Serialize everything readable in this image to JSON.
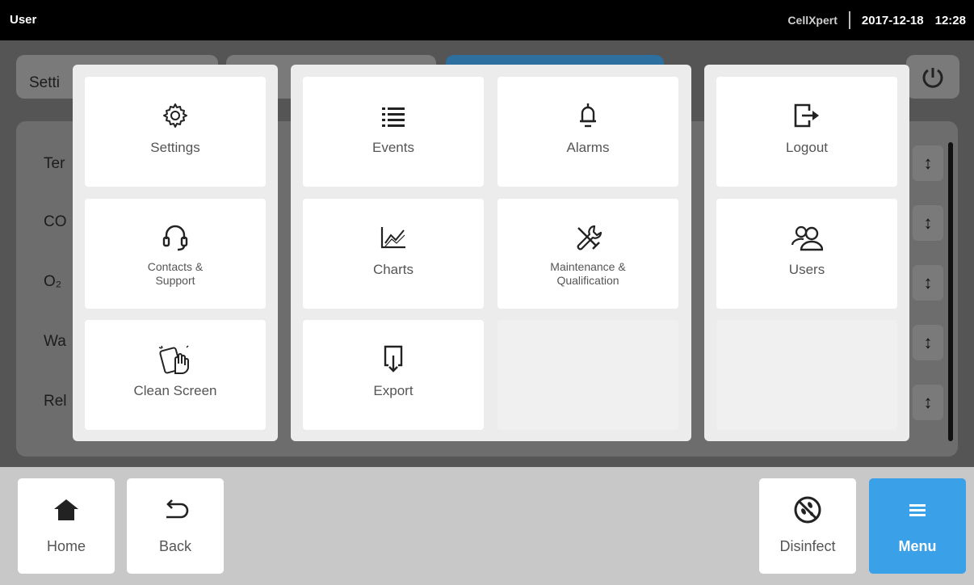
{
  "topbar": {
    "user": "User",
    "app_name": "CellXpert",
    "date": "2017-12-18",
    "time": "12:28"
  },
  "background": {
    "tab_label": "Setti",
    "rows": [
      "Ter",
      "CO",
      "O₂",
      "Wa",
      "Rel"
    ]
  },
  "menu": {
    "settings": "Settings",
    "contacts_support": "Contacts &\nSupport",
    "clean_screen": "Clean Screen",
    "events": "Events",
    "alarms": "Alarms",
    "charts": "Charts",
    "maintenance": "Maintenance &\nQualification",
    "export": "Export",
    "logout": "Logout",
    "users": "Users"
  },
  "bottombar": {
    "home": "Home",
    "back": "Back",
    "disinfect": "Disinfect",
    "menu": "Menu"
  },
  "colors": {
    "accent": "#3aa0e8",
    "topbar": "#000000"
  }
}
